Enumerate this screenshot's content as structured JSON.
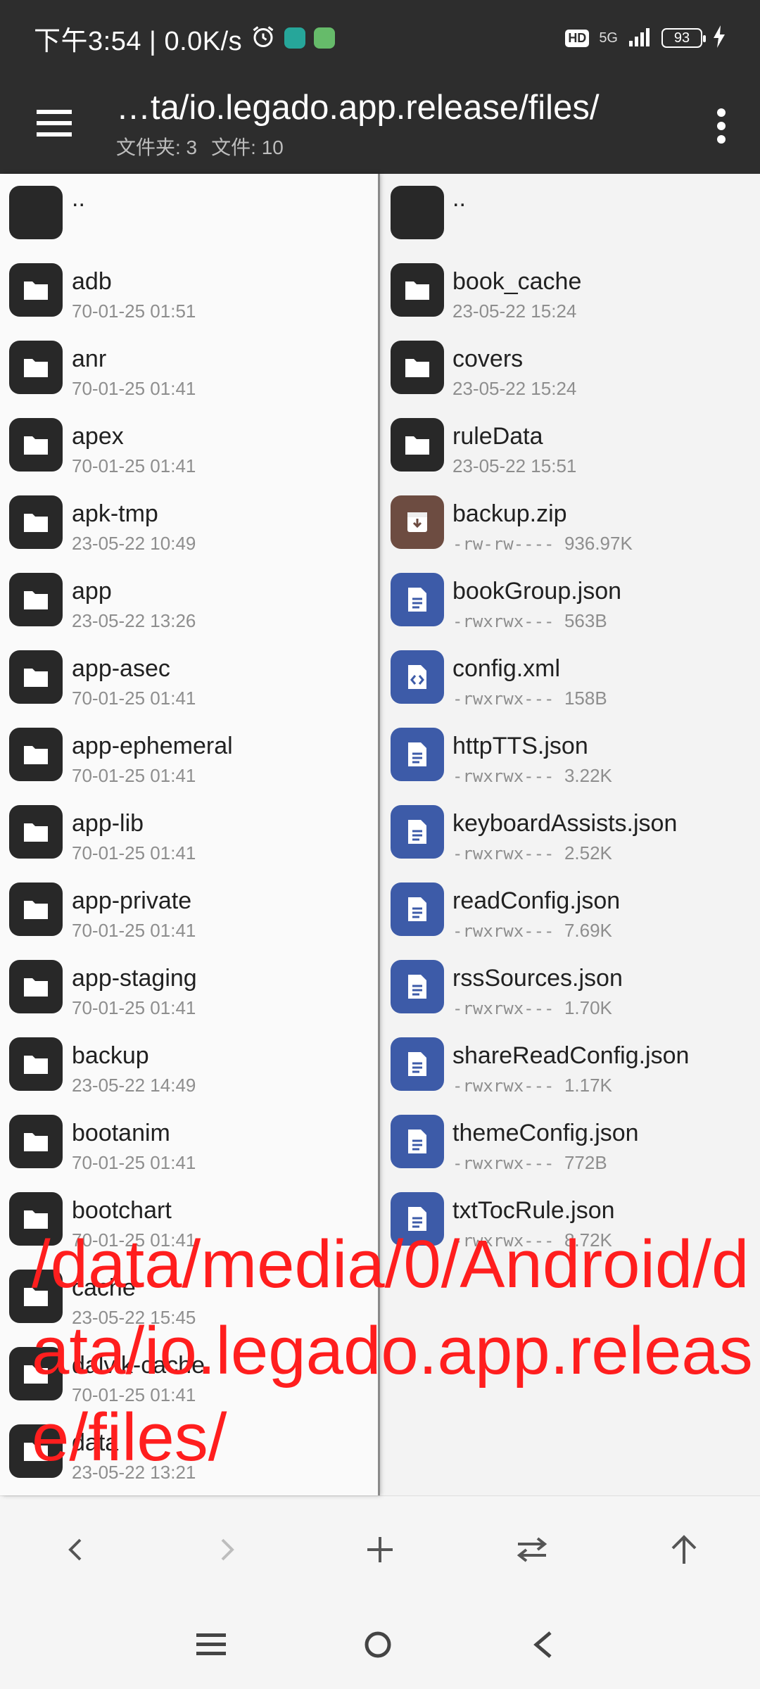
{
  "status_bar": {
    "time_speed": "下午3:54 | 0.0K/s",
    "hd": "HD",
    "network": "5G",
    "battery": "93"
  },
  "toolbar": {
    "title": "…ta/io.legado.app.release/files/",
    "folders_count": "文件夹: 3",
    "files_count": "文件: 10"
  },
  "left_pane": {
    "parent": "..",
    "items": [
      {
        "name": "adb",
        "meta": "70-01-25 01:51"
      },
      {
        "name": "anr",
        "meta": "70-01-25 01:41"
      },
      {
        "name": "apex",
        "meta": "70-01-25 01:41"
      },
      {
        "name": "apk-tmp",
        "meta": "23-05-22 10:49"
      },
      {
        "name": "app",
        "meta": "23-05-22 13:26"
      },
      {
        "name": "app-asec",
        "meta": "70-01-25 01:41"
      },
      {
        "name": "app-ephemeral",
        "meta": "70-01-25 01:41"
      },
      {
        "name": "app-lib",
        "meta": "70-01-25 01:41"
      },
      {
        "name": "app-private",
        "meta": "70-01-25 01:41"
      },
      {
        "name": "app-staging",
        "meta": "70-01-25 01:41"
      },
      {
        "name": "backup",
        "meta": "23-05-22 14:49"
      },
      {
        "name": "bootanim",
        "meta": "70-01-25 01:41"
      },
      {
        "name": "bootchart",
        "meta": "70-01-25 01:41"
      },
      {
        "name": "cache",
        "meta": "23-05-22 15:45"
      },
      {
        "name": "dalvik-cache",
        "meta": "70-01-25 01:41"
      },
      {
        "name": "data",
        "meta": "23-05-22 13:21"
      }
    ]
  },
  "right_pane": {
    "parent": "..",
    "folders": [
      {
        "name": "book_cache",
        "meta": "23-05-22 15:24"
      },
      {
        "name": "covers",
        "meta": "23-05-22 15:24"
      },
      {
        "name": "ruleData",
        "meta": "23-05-22 15:51"
      }
    ],
    "files": [
      {
        "name": "backup.zip",
        "perm": "-rw-rw----",
        "size": "936.97K",
        "icon": "archive-icon"
      },
      {
        "name": "bookGroup.json",
        "perm": "-rwxrwx---",
        "size": "563B",
        "icon": "document-icon"
      },
      {
        "name": "config.xml",
        "perm": "-rwxrwx---",
        "size": "158B",
        "icon": "code-file-icon"
      },
      {
        "name": "httpTTS.json",
        "perm": "-rwxrwx---",
        "size": "3.22K",
        "icon": "document-icon"
      },
      {
        "name": "keyboardAssists.json",
        "perm": "-rwxrwx---",
        "size": "2.52K",
        "icon": "document-icon"
      },
      {
        "name": "readConfig.json",
        "perm": "-rwxrwx---",
        "size": "7.69K",
        "icon": "document-icon"
      },
      {
        "name": "rssSources.json",
        "perm": "-rwxrwx---",
        "size": "1.70K",
        "icon": "document-icon"
      },
      {
        "name": "shareReadConfig.json",
        "perm": "-rwxrwx---",
        "size": "1.17K",
        "icon": "document-icon"
      },
      {
        "name": "themeConfig.json",
        "perm": "-rwxrwx---",
        "size": "772B",
        "icon": "document-icon"
      },
      {
        "name": "txtTocRule.json",
        "perm": "-rwxrwx---",
        "size": "8.72K",
        "icon": "document-icon"
      }
    ]
  },
  "overlay": {
    "text": "/data/media/0/Android/data/io.legado.app.release/files/"
  },
  "bottom_toolbar": {
    "buttons": [
      "back-icon",
      "forward-icon",
      "add-icon",
      "swap-icon",
      "up-icon"
    ]
  },
  "colors": {
    "header_bg": "#2d2d2d",
    "folder_icon_bg": "#282828",
    "doc_icon_bg": "#3d5ba8",
    "zip_icon_bg": "#6d4c41",
    "overlay_text": "#ff1e1e"
  }
}
